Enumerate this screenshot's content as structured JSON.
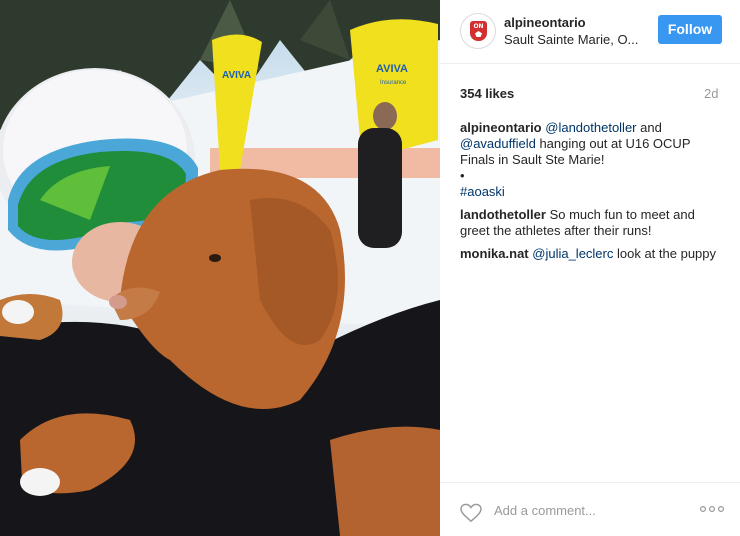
{
  "post": {
    "username": "alpineontario",
    "location": "Sault Sainte Marie, O...",
    "follow_label": "Follow",
    "likes": "354 likes",
    "time_ago": "2d",
    "avatar_badge_text": "ON"
  },
  "photo": {
    "banner_text_1": "AVIVA",
    "banner_text_2": "AVIVA",
    "banner_sub": "Insurance"
  },
  "comments": [
    {
      "user": "alpineontario",
      "m1": "@landothetoller",
      "t1": " and ",
      "m2": "@avaduffield",
      "t2": " hanging out at U16 OCUP Finals in Sault Ste Marie!",
      "bullet": "•",
      "hashtag": "#aoaski"
    },
    {
      "user": "landothetoller",
      "text": " So much fun to meet and greet the athletes after their runs!"
    },
    {
      "user": "monika.nat",
      "mention": "@julia_leclerc",
      "text": " look at the puppy"
    }
  ],
  "add_comment": {
    "placeholder": "Add a comment...",
    "options_icon": "ellipsis-icon",
    "like_icon": "heart-icon"
  }
}
